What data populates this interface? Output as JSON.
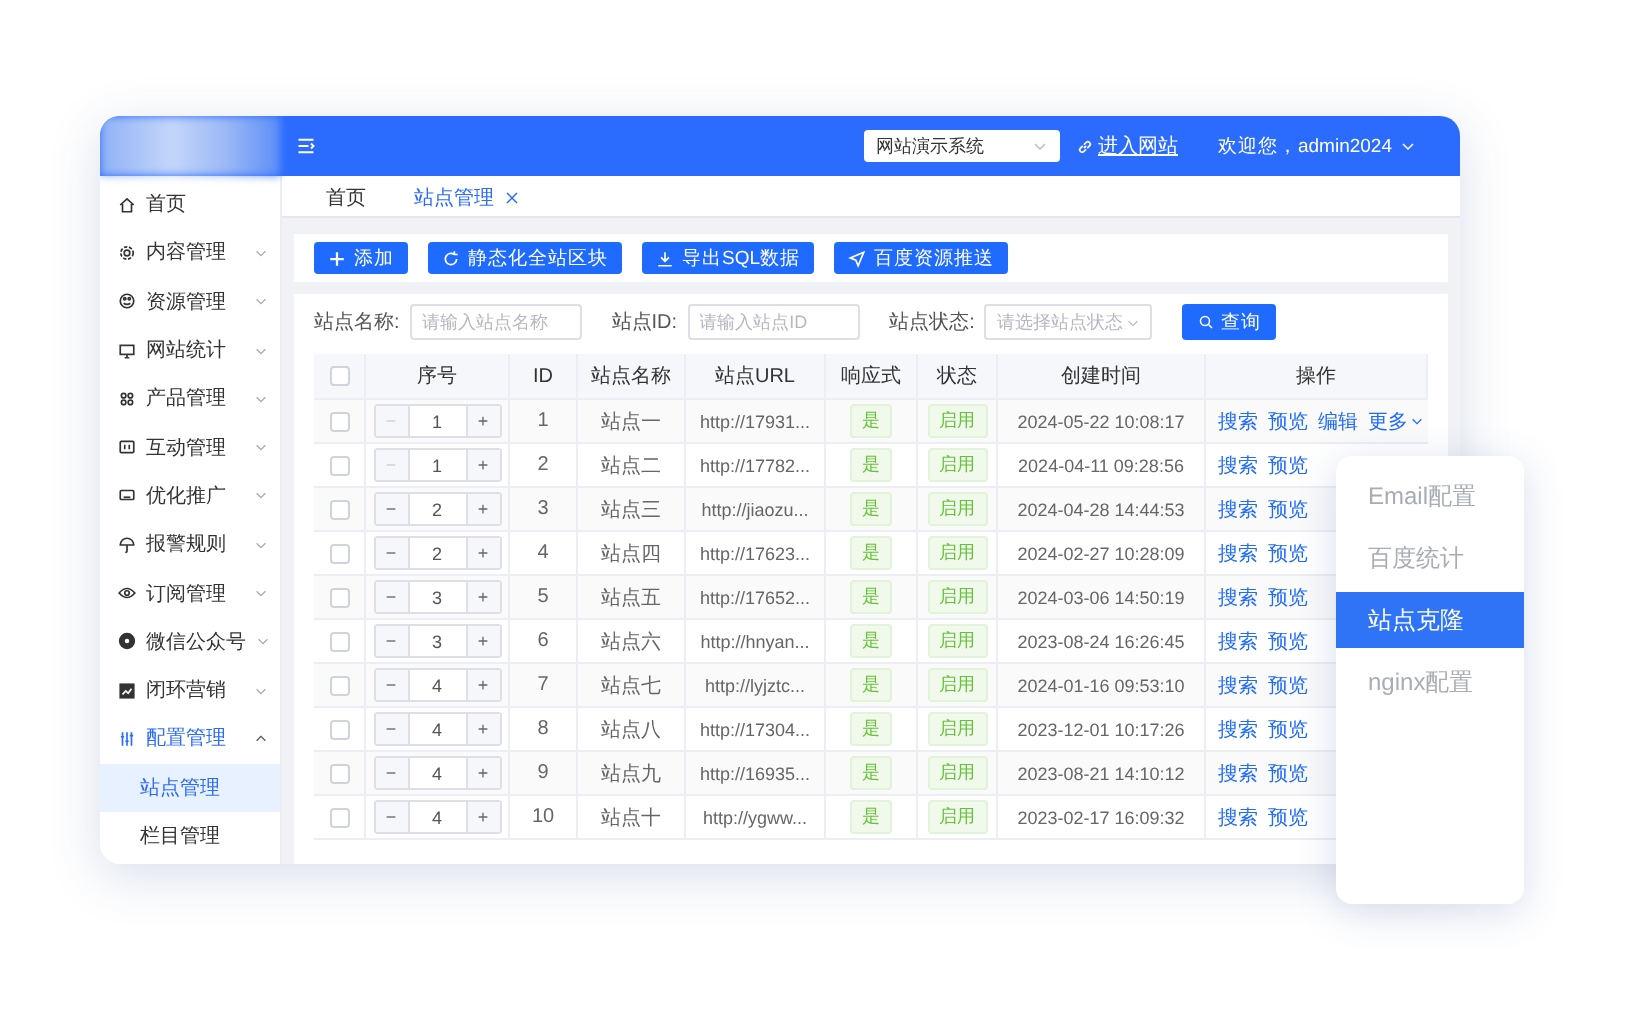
{
  "header": {
    "system_select": {
      "value": "网站演示系统"
    },
    "site_link": "进入网站",
    "user": "欢迎您，admin2024"
  },
  "sidebar": {
    "items": [
      {
        "label": "首页"
      },
      {
        "label": "内容管理",
        "expanded": false
      },
      {
        "label": "资源管理",
        "expanded": false
      },
      {
        "label": "网站统计",
        "expanded": false
      },
      {
        "label": "产品管理",
        "expanded": false
      },
      {
        "label": "互动管理",
        "expanded": false
      },
      {
        "label": "优化推广",
        "expanded": false
      },
      {
        "label": "报警规则",
        "expanded": false
      },
      {
        "label": "订阅管理",
        "expanded": false
      },
      {
        "label": "微信公众号",
        "expanded": false
      },
      {
        "label": "闭环营销",
        "expanded": false
      },
      {
        "label": "配置管理",
        "expanded": true,
        "children": [
          {
            "label": "站点管理",
            "selected": true
          },
          {
            "label": "栏目管理",
            "selected": false
          }
        ]
      }
    ]
  },
  "tabs": [
    {
      "label": "首页",
      "selected": false,
      "closable": false
    },
    {
      "label": "站点管理",
      "selected": true,
      "closable": true
    }
  ],
  "toolbar": {
    "buttons": [
      "添加",
      "静态化全站区块",
      "导出SQL数据",
      "百度资源推送"
    ]
  },
  "filters": {
    "fields": [
      {
        "label": "站点名称:",
        "placeholder": "请输入站点名称",
        "kind": "input"
      },
      {
        "label": "站点ID:",
        "placeholder": "请输入站点ID",
        "kind": "input"
      },
      {
        "label": "站点状态:",
        "placeholder": "请选择站点状态",
        "kind": "select"
      }
    ],
    "search_button": "查询"
  },
  "table": {
    "header_checked": false,
    "columns": [
      "序号",
      "ID",
      "站点名称",
      "站点URL",
      "响应式",
      "状态",
      "创建时间",
      "操作"
    ],
    "rows": [
      {
        "checked": false,
        "sort": "1",
        "minus_disabled": true,
        "id": "1",
        "name": "站点一",
        "url": "http://17931...",
        "responsive": "是",
        "status": "启用",
        "created": "2024-05-22 10:08:17",
        "actions": [
          "搜索",
          "预览",
          "编辑"
        ],
        "more": "更多"
      },
      {
        "checked": false,
        "sort": "1",
        "minus_disabled": true,
        "id": "2",
        "name": "站点二",
        "url": "http://17782...",
        "responsive": "是",
        "status": "启用",
        "created": "2024-04-11 09:28:56",
        "actions": [
          "搜索",
          "预览"
        ]
      },
      {
        "checked": false,
        "sort": "2",
        "minus_disabled": false,
        "id": "3",
        "name": "站点三",
        "url": "http://jiaozu...",
        "responsive": "是",
        "status": "启用",
        "created": "2024-04-28 14:44:53",
        "actions": [
          "搜索",
          "预览"
        ]
      },
      {
        "checked": false,
        "sort": "2",
        "minus_disabled": false,
        "id": "4",
        "name": "站点四",
        "url": "http://17623...",
        "responsive": "是",
        "status": "启用",
        "created": "2024-02-27 10:28:09",
        "actions": [
          "搜索",
          "预览"
        ]
      },
      {
        "checked": false,
        "sort": "3",
        "minus_disabled": false,
        "id": "5",
        "name": "站点五",
        "url": "http://17652...",
        "responsive": "是",
        "status": "启用",
        "created": "2024-03-06 14:50:19",
        "actions": [
          "搜索",
          "预览"
        ]
      },
      {
        "checked": false,
        "sort": "3",
        "minus_disabled": false,
        "id": "6",
        "name": "站点六",
        "url": "http://hnyan...",
        "responsive": "是",
        "status": "启用",
        "created": "2023-08-24 16:26:45",
        "actions": [
          "搜索",
          "预览"
        ]
      },
      {
        "checked": false,
        "sort": "4",
        "minus_disabled": false,
        "id": "7",
        "name": "站点七",
        "url": "http://lyjztc...",
        "responsive": "是",
        "status": "启用",
        "created": "2024-01-16 09:53:10",
        "actions": [
          "搜索",
          "预览"
        ]
      },
      {
        "checked": false,
        "sort": "4",
        "minus_disabled": false,
        "id": "8",
        "name": "站点八",
        "url": "http://17304...",
        "responsive": "是",
        "status": "启用",
        "created": "2023-12-01 10:17:26",
        "actions": [
          "搜索",
          "预览"
        ]
      },
      {
        "checked": false,
        "sort": "4",
        "minus_disabled": false,
        "id": "9",
        "name": "站点九",
        "url": "http://16935...",
        "responsive": "是",
        "status": "启用",
        "created": "2023-08-21 14:10:12",
        "actions": [
          "搜索",
          "预览"
        ]
      },
      {
        "checked": false,
        "sort": "4",
        "minus_disabled": false,
        "id": "10",
        "name": "站点十",
        "url": "http://ygww...",
        "responsive": "是",
        "status": "启用",
        "created": "2023-02-17 16:09:32",
        "actions": [
          "搜索",
          "预览"
        ]
      }
    ]
  },
  "more_menu": {
    "items": [
      {
        "label": "Email配置",
        "selected": false
      },
      {
        "label": "百度统计",
        "selected": false
      },
      {
        "label": "站点克隆",
        "selected": true
      },
      {
        "label": "nginx配置",
        "selected": false
      }
    ]
  }
}
